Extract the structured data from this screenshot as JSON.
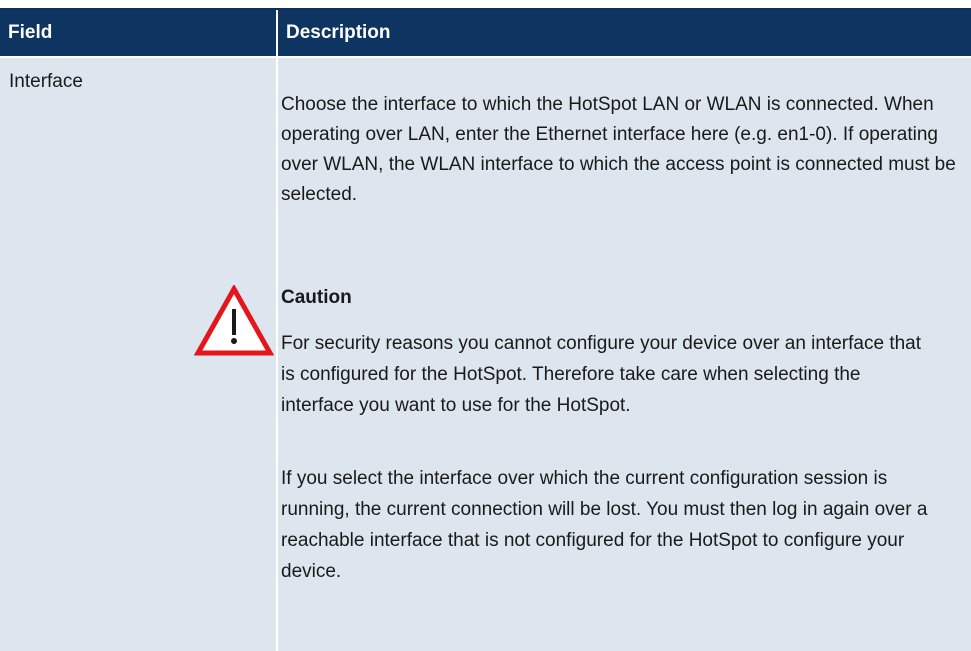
{
  "table": {
    "headers": {
      "field": "Field",
      "description": "Description"
    },
    "rows": [
      {
        "field": "Interface",
        "description": "Choose the interface to which the HotSpot LAN or WLAN is connected. When operating over LAN, enter the Ethernet inter­face here (e.g. en1-0). If operating over WLAN, the WLAN inter­face to which the access point is connected must be selected.",
        "caution": {
          "icon": "warning-triangle-icon",
          "title": "Caution",
          "paragraphs": [
            "For security reasons you cannot configure your device over an interface that is configured for the HotSpot. Therefore take care when selecting the interface you want to use for the HotSpot.",
            "If you select the interface over which the current configura­tion session is running, the current connection will be lost. You must then log in again over a reachable interface that is not configured for the HotSpot to configure your device."
          ]
        }
      }
    ]
  },
  "colors": {
    "header_bg": "#0e3562",
    "header_text": "#ffffff",
    "cell_bg": "#dde5ee",
    "warning_red": "#e4161b"
  }
}
